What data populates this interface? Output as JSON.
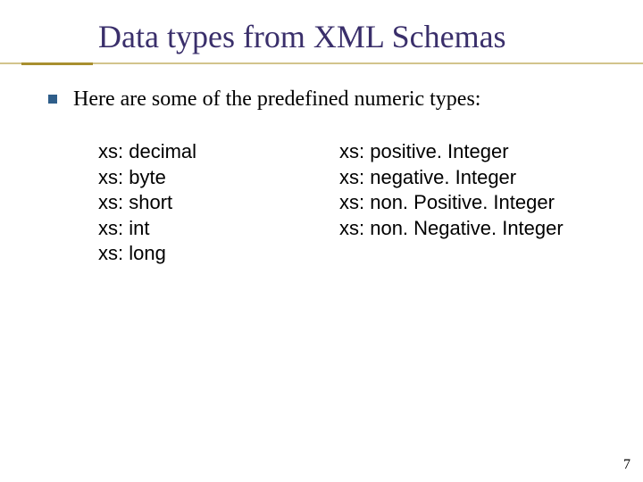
{
  "title": "Data types from XML Schemas",
  "lead": "Here are some of the predefined numeric types:",
  "left_column": [
    "xs: decimal",
    "xs: byte",
    "xs: short",
    "xs: int",
    "xs: long"
  ],
  "right_column": [
    "xs: positive. Integer",
    "xs: negative. Integer",
    "xs: non. Positive. Integer",
    "xs: non. Negative. Integer"
  ],
  "page_number": "7"
}
